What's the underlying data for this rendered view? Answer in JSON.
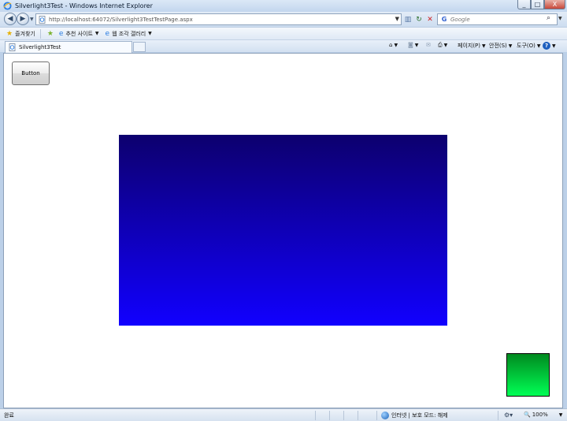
{
  "window": {
    "title": "Silverlight3Test - Windows Internet Explorer",
    "controls": {
      "minimize": "_",
      "maximize": "□",
      "close": "X"
    }
  },
  "address_bar": {
    "url": "http://localhost:64072/Silverlight3TestTestPage.aspx",
    "search_placeholder": "Google"
  },
  "favorites_bar": {
    "favorites_label": "즐겨찾기",
    "suggested_sites_label": "추천 사이트",
    "web_slice_gallery_label": "웹 조각 갤러리"
  },
  "tab": {
    "label": "Silverlight3Test"
  },
  "command_bar": {
    "page_label": "페이지(P)",
    "safety_label": "안전(S)",
    "tools_label": "도구(O)",
    "help_label": "?"
  },
  "content": {
    "button_label": "Button",
    "blue_gradient": [
      "#0d006e",
      "#1100ff"
    ],
    "green_gradient": [
      "#008a1f",
      "#00ff55"
    ]
  },
  "status_bar": {
    "status_text": "완료",
    "zone_text": "인터넷 | 보호 모드: 해제",
    "zoom_text": "100%"
  },
  "colors": {
    "chrome_accent": "#bcd0e8",
    "close_button": "#c7483a"
  }
}
